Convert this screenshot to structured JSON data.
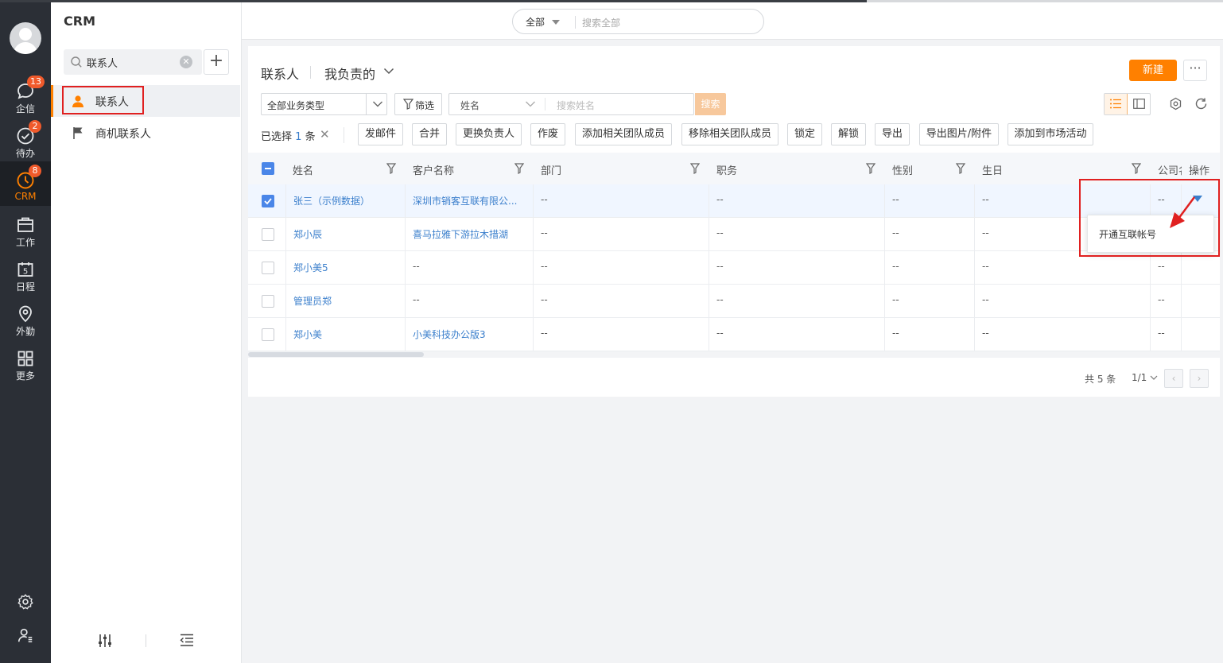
{
  "app": {
    "title": "CRM"
  },
  "rail": {
    "items": [
      {
        "label": "企信",
        "badge": "13",
        "icon": "chat-bubble-icon"
      },
      {
        "label": "待办",
        "badge": "2",
        "icon": "check-circle-icon"
      },
      {
        "label": "CRM",
        "badge": "8",
        "icon": "clock-icon"
      },
      {
        "label": "工作",
        "badge": "",
        "icon": "briefcase-icon"
      },
      {
        "label": "日程",
        "badge": "",
        "icon": "calendar-icon"
      },
      {
        "label": "外勤",
        "badge": "",
        "icon": "location-pin-icon"
      },
      {
        "label": "更多",
        "badge": "",
        "icon": "grid-icon"
      }
    ],
    "calendar_day": "5"
  },
  "side": {
    "search_value": "联系人",
    "items": [
      {
        "label": "联系人",
        "icon": "contact-person-icon"
      },
      {
        "label": "商机联系人",
        "icon": "flag-icon"
      }
    ]
  },
  "topbar": {
    "scope": "全部",
    "placeholder": "搜索全部"
  },
  "page": {
    "crumb": "联系人",
    "view": "我负责的",
    "new_label": "新建",
    "more_label": "···"
  },
  "filters": {
    "biz_type": "全部业务类型",
    "filter_label": "筛选",
    "field": "姓名",
    "search_placeholder": "搜索姓名",
    "search_label": "搜索"
  },
  "batch": {
    "selected_text": "已选择",
    "selected_count": "1",
    "selected_unit": "条",
    "buttons": [
      "发邮件",
      "合并",
      "更换负责人",
      "作废",
      "添加相关团队成员",
      "移除相关团队成员",
      "锁定",
      "解锁",
      "导出",
      "导出图片/附件",
      "添加到市场活动"
    ]
  },
  "table": {
    "columns": [
      "姓名",
      "客户名称",
      "部门",
      "职务",
      "性别",
      "生日",
      "公司名",
      "操作"
    ],
    "rows": [
      {
        "checked": true,
        "cells": [
          "张三（示例数据）",
          "深圳市销客互联有限公...",
          "--",
          "--",
          "--",
          "--",
          "--"
        ]
      },
      {
        "checked": false,
        "cells": [
          "郑小辰",
          "喜马拉雅下游拉木措湖",
          "--",
          "--",
          "--",
          "--",
          "--"
        ]
      },
      {
        "checked": false,
        "cells": [
          "郑小美5",
          "--",
          "--",
          "--",
          "--",
          "--",
          "--"
        ]
      },
      {
        "checked": false,
        "cells": [
          "管理员郑",
          "--",
          "--",
          "--",
          "--",
          "--",
          "--"
        ]
      },
      {
        "checked": false,
        "cells": [
          "郑小美",
          "小美科技办公版3",
          "--",
          "--",
          "--",
          "--",
          "--"
        ]
      }
    ]
  },
  "menu": {
    "item": "开通互联帐号"
  },
  "pager": {
    "total": "共 5 条",
    "page": "1/1"
  },
  "colors": {
    "accent": "#ff8000",
    "link": "#3b7fcc",
    "rail": "#2b2f36",
    "highlight": "#e02020"
  }
}
